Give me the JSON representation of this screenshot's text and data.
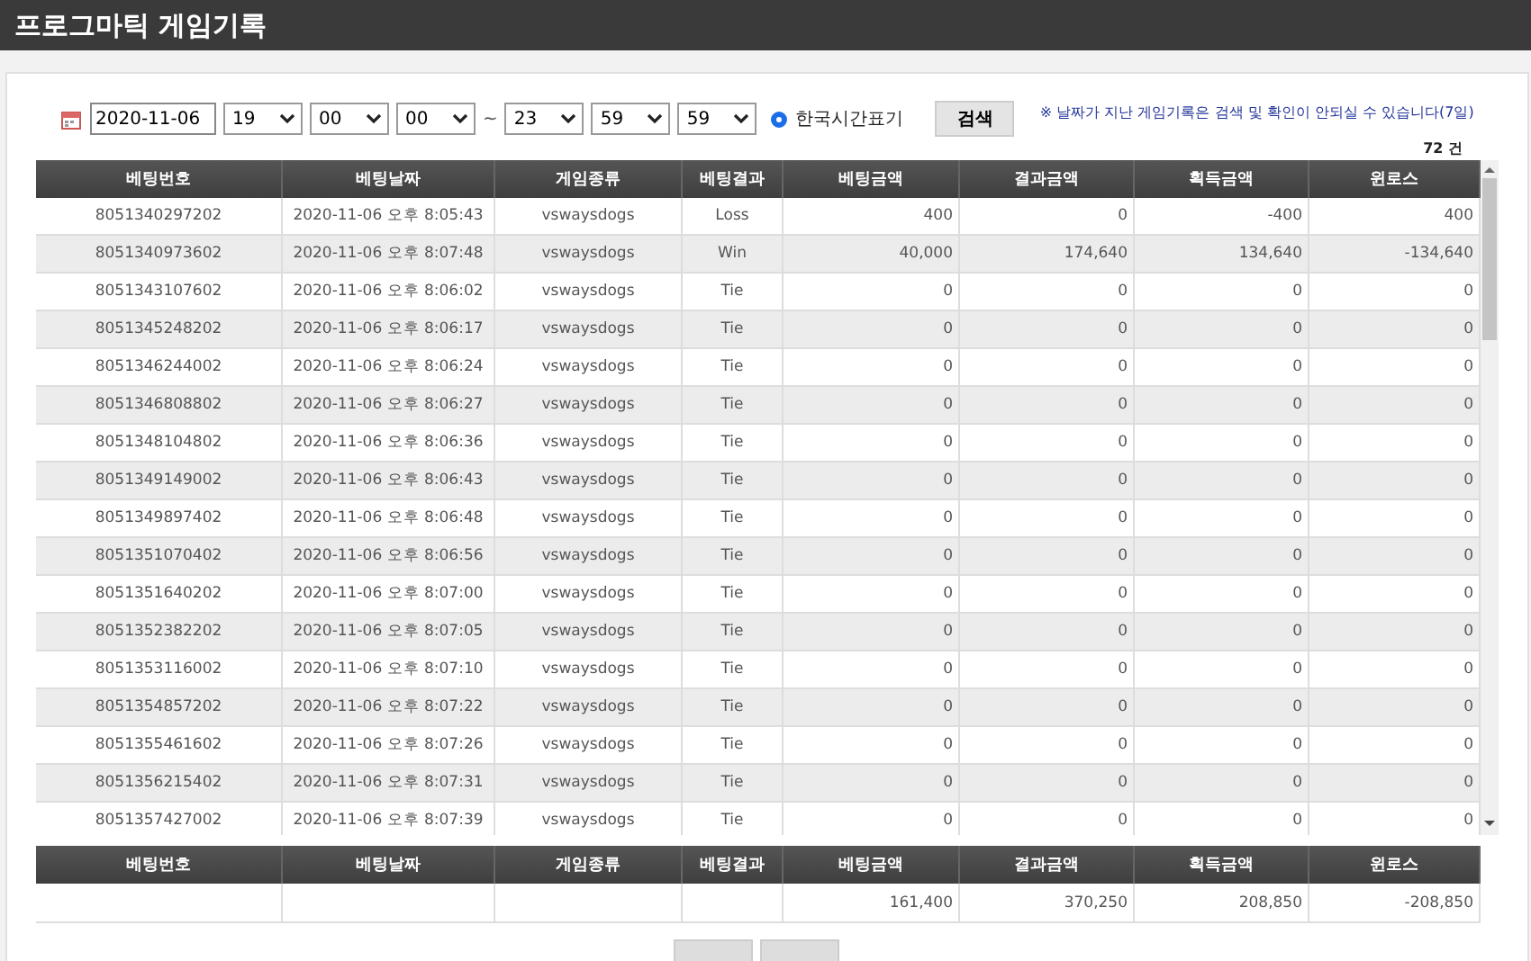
{
  "title": "프로그마틱 게임기록",
  "filter": {
    "date": "2020-11-06",
    "from": [
      "19",
      "00",
      "00"
    ],
    "separator": "~",
    "to": [
      "23",
      "59",
      "59"
    ],
    "korean_time": {
      "label": "한국시간표기",
      "selected": true
    },
    "search_button": "검색",
    "note": "※ 날짜가 지난 게임기록은 검색 및 확인이 안되실 수 있습니다(7일)"
  },
  "count": "72 건",
  "table": {
    "columns": [
      "베팅번호",
      "베팅날짜",
      "게임종류",
      "베팅결과",
      "베팅금액",
      "결과금액",
      "획득금액",
      "윈로스"
    ],
    "rows": [
      [
        "8051340297202",
        "2020-11-06 오후 8:05:43",
        "vswaysdogs",
        "Loss",
        "400",
        "0",
        "-400",
        "400"
      ],
      [
        "8051340973602",
        "2020-11-06 오후 8:07:48",
        "vswaysdogs",
        "Win",
        "40,000",
        "174,640",
        "134,640",
        "-134,640"
      ],
      [
        "8051343107602",
        "2020-11-06 오후 8:06:02",
        "vswaysdogs",
        "Tie",
        "0",
        "0",
        "0",
        "0"
      ],
      [
        "8051345248202",
        "2020-11-06 오후 8:06:17",
        "vswaysdogs",
        "Tie",
        "0",
        "0",
        "0",
        "0"
      ],
      [
        "8051346244002",
        "2020-11-06 오후 8:06:24",
        "vswaysdogs",
        "Tie",
        "0",
        "0",
        "0",
        "0"
      ],
      [
        "8051346808802",
        "2020-11-06 오후 8:06:27",
        "vswaysdogs",
        "Tie",
        "0",
        "0",
        "0",
        "0"
      ],
      [
        "8051348104802",
        "2020-11-06 오후 8:06:36",
        "vswaysdogs",
        "Tie",
        "0",
        "0",
        "0",
        "0"
      ],
      [
        "8051349149002",
        "2020-11-06 오후 8:06:43",
        "vswaysdogs",
        "Tie",
        "0",
        "0",
        "0",
        "0"
      ],
      [
        "8051349897402",
        "2020-11-06 오후 8:06:48",
        "vswaysdogs",
        "Tie",
        "0",
        "0",
        "0",
        "0"
      ],
      [
        "8051351070402",
        "2020-11-06 오후 8:06:56",
        "vswaysdogs",
        "Tie",
        "0",
        "0",
        "0",
        "0"
      ],
      [
        "8051351640202",
        "2020-11-06 오후 8:07:00",
        "vswaysdogs",
        "Tie",
        "0",
        "0",
        "0",
        "0"
      ],
      [
        "8051352382202",
        "2020-11-06 오후 8:07:05",
        "vswaysdogs",
        "Tie",
        "0",
        "0",
        "0",
        "0"
      ],
      [
        "8051353116002",
        "2020-11-06 오후 8:07:10",
        "vswaysdogs",
        "Tie",
        "0",
        "0",
        "0",
        "0"
      ],
      [
        "8051354857202",
        "2020-11-06 오후 8:07:22",
        "vswaysdogs",
        "Tie",
        "0",
        "0",
        "0",
        "0"
      ],
      [
        "8051355461602",
        "2020-11-06 오후 8:07:26",
        "vswaysdogs",
        "Tie",
        "0",
        "0",
        "0",
        "0"
      ],
      [
        "8051356215402",
        "2020-11-06 오후 8:07:31",
        "vswaysdogs",
        "Tie",
        "0",
        "0",
        "0",
        "0"
      ],
      [
        "8051357427002",
        "2020-11-06 오후 8:07:39",
        "vswaysdogs",
        "Tie",
        "0",
        "0",
        "0",
        "0"
      ]
    ]
  },
  "summary": {
    "columns": [
      "베팅번호",
      "베팅날짜",
      "게임종류",
      "베팅결과",
      "베팅금액",
      "결과금액",
      "획득금액",
      "윈로스"
    ],
    "totals": [
      "161,400",
      "370,250",
      "208,850",
      "-208,850"
    ]
  }
}
